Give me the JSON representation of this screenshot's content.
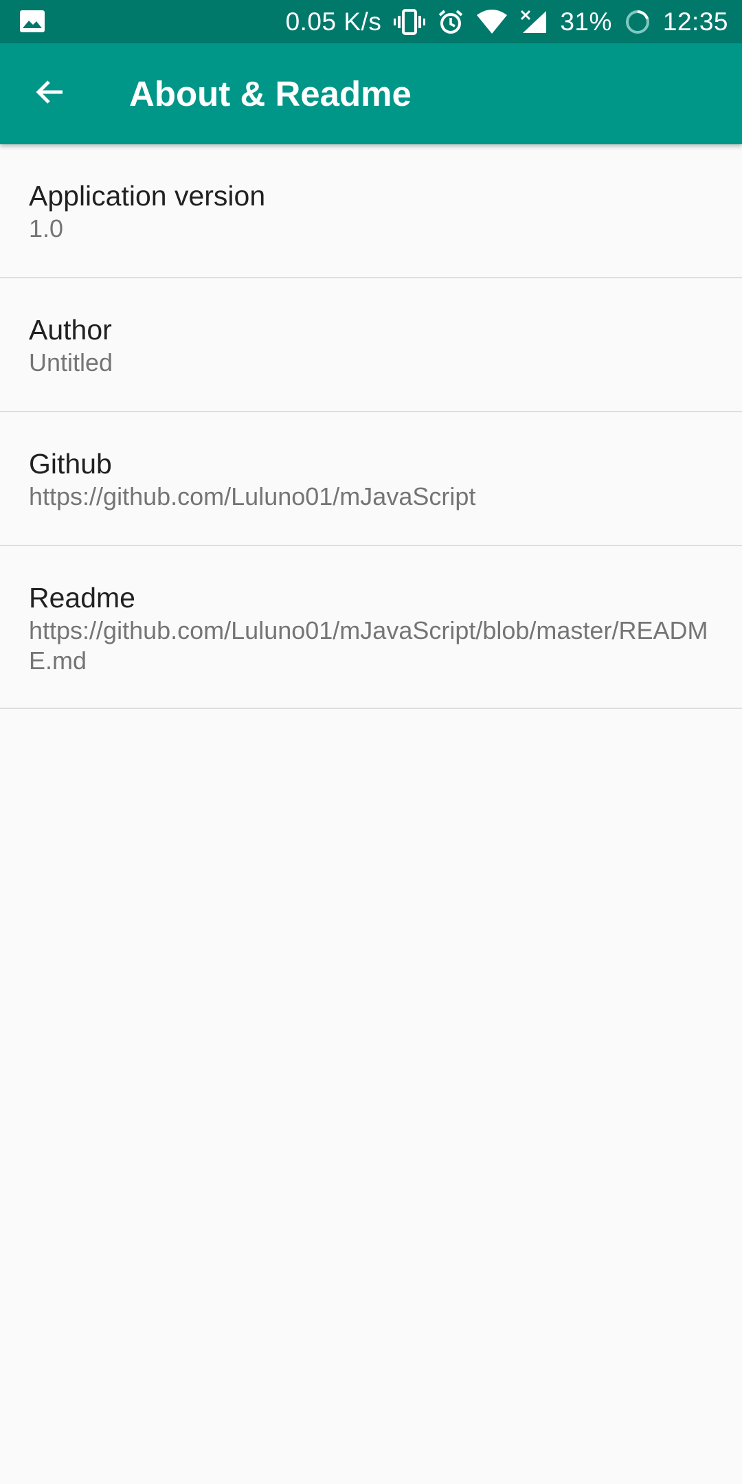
{
  "status_bar": {
    "network_speed": "0.05 K/s",
    "battery": "31%",
    "time": "12:35",
    "icons": [
      "image-icon",
      "vibrate-icon",
      "alarm-icon",
      "wifi-icon",
      "signal-icon",
      "battery-icon"
    ]
  },
  "app_bar": {
    "title": "About & Readme",
    "back_icon": "arrow-back-icon",
    "color": "#009688",
    "status_color": "#00796b"
  },
  "items": [
    {
      "title": "Application version",
      "value": "1.0"
    },
    {
      "title": "Author",
      "value": "Untitled"
    },
    {
      "title": "Github",
      "value": "https://github.com/Luluno01/mJavaScript"
    },
    {
      "title": "Readme",
      "value": "https://github.com/Luluno01/mJavaScript/blob/master/README.md"
    }
  ]
}
